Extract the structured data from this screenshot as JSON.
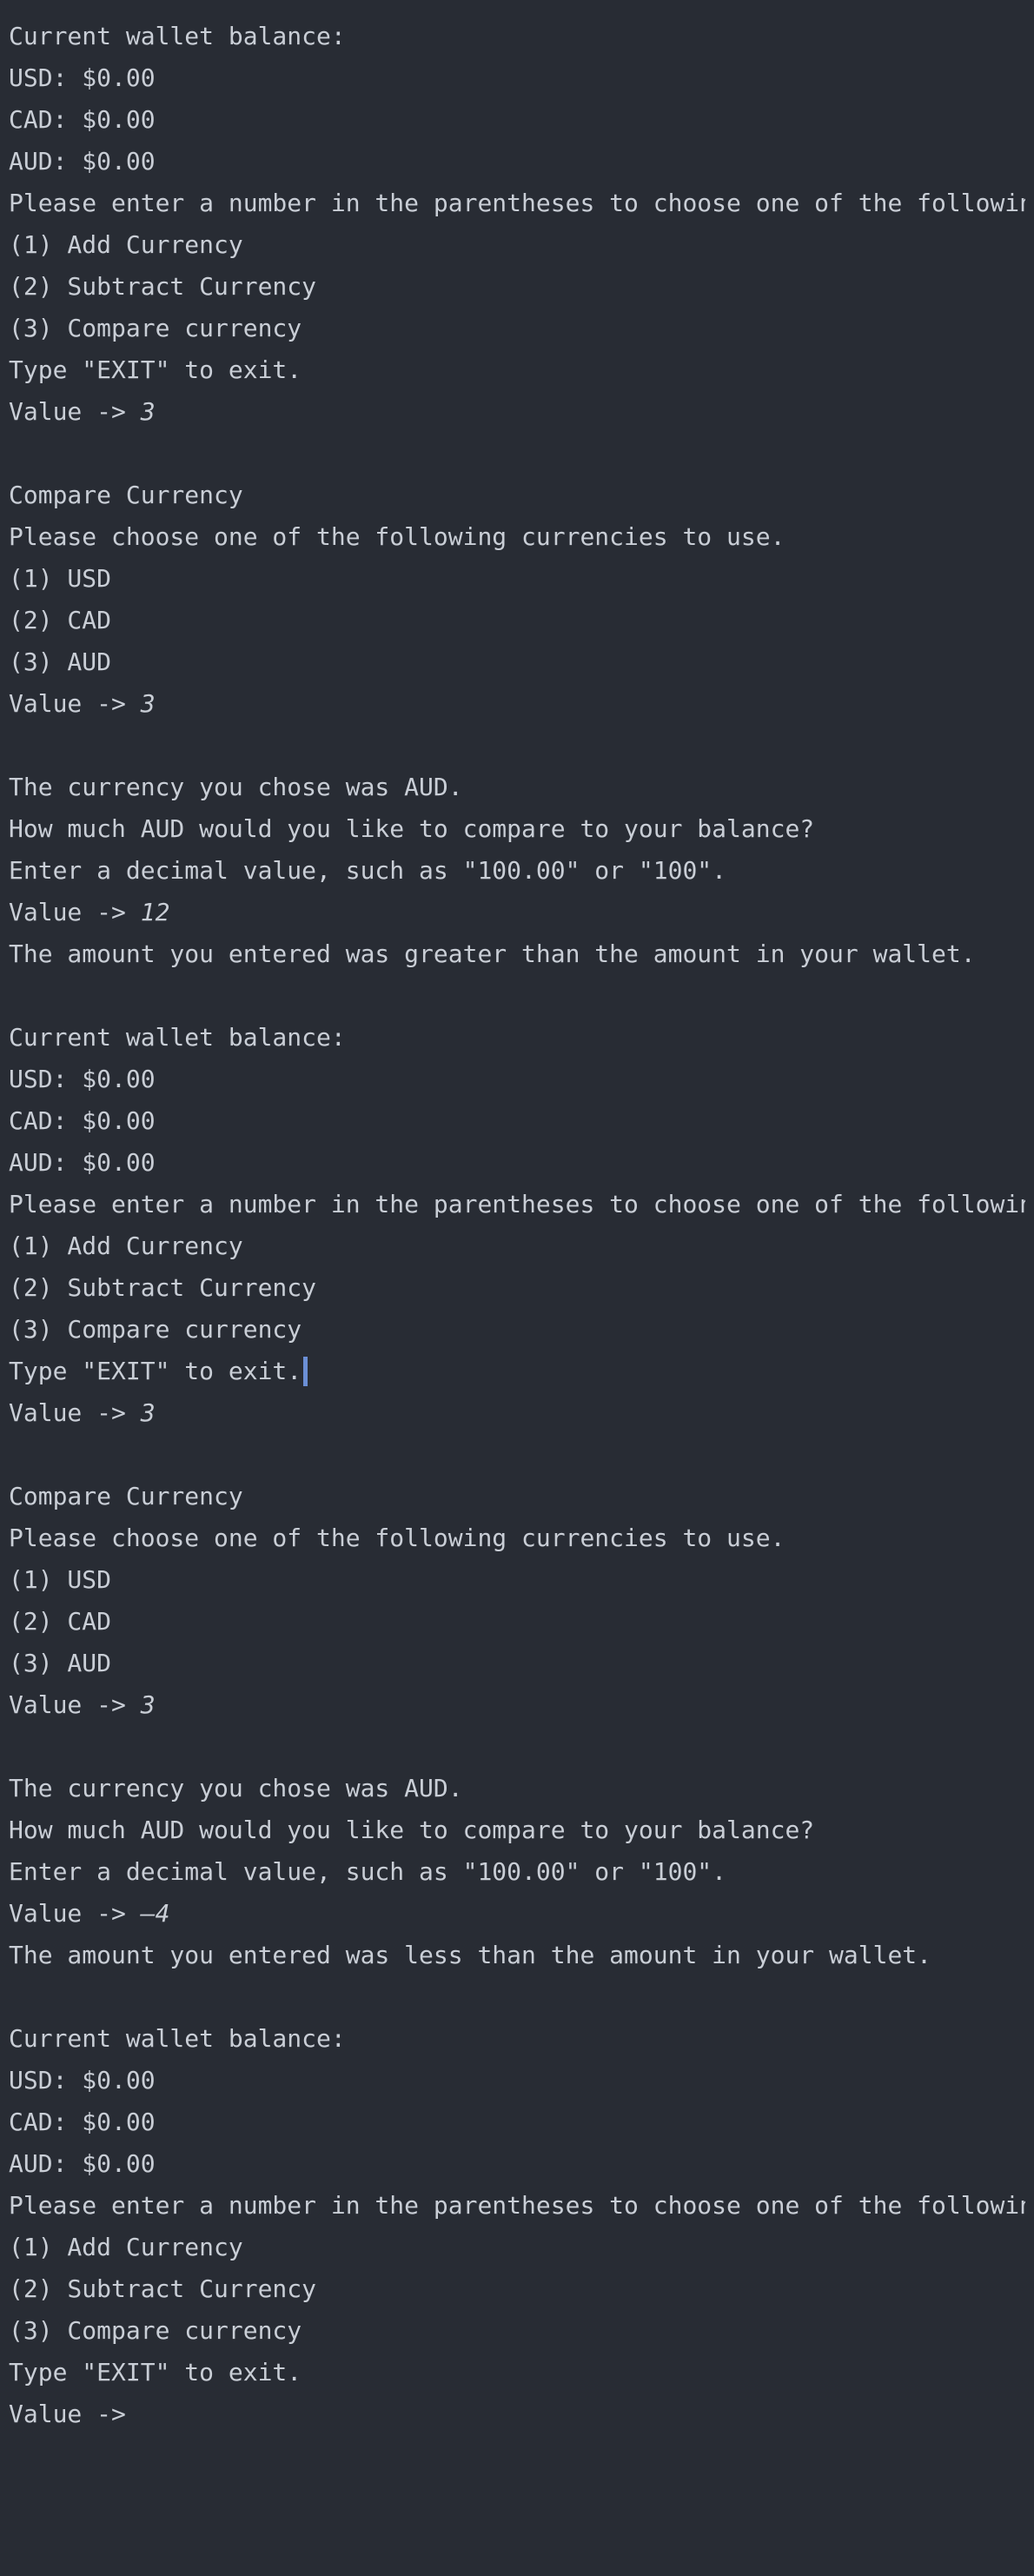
{
  "terminal": {
    "lines": [
      {
        "text": "Current wallet balance:"
      },
      {
        "text": "USD: $0.00"
      },
      {
        "text": "CAD: $0.00"
      },
      {
        "text": "AUD: $0.00"
      },
      {
        "text": "Please enter a number in the parentheses to choose one of the following."
      },
      {
        "text": "(1) Add Currency"
      },
      {
        "text": "(2) Subtract Currency"
      },
      {
        "text": "(3) Compare currency"
      },
      {
        "text": "Type \"EXIT\" to exit."
      },
      {
        "prompt": "Value -> ",
        "input": "3"
      },
      {
        "text": ""
      },
      {
        "text": "Compare Currency"
      },
      {
        "text": "Please choose one of the following currencies to use."
      },
      {
        "text": "(1) USD"
      },
      {
        "text": "(2) CAD"
      },
      {
        "text": "(3) AUD"
      },
      {
        "prompt": "Value -> ",
        "input": "3"
      },
      {
        "text": ""
      },
      {
        "text": "The currency you chose was AUD."
      },
      {
        "text": "How much AUD would you like to compare to your balance?"
      },
      {
        "text": "Enter a decimal value, such as \"100.00\" or \"100\"."
      },
      {
        "prompt": "Value -> ",
        "input": "12"
      },
      {
        "text": "The amount you entered was greater than the amount in your wallet."
      },
      {
        "text": ""
      },
      {
        "text": "Current wallet balance:"
      },
      {
        "text": "USD: $0.00"
      },
      {
        "text": "CAD: $0.00"
      },
      {
        "text": "AUD: $0.00"
      },
      {
        "text": "Please enter a number in the parentheses to choose one of the following."
      },
      {
        "text": "(1) Add Currency"
      },
      {
        "text": "(2) Subtract Currency"
      },
      {
        "text": "(3) Compare currency"
      },
      {
        "text": "Type \"EXIT\" to exit.",
        "cursor": true
      },
      {
        "prompt": "Value -> ",
        "input": "3"
      },
      {
        "text": ""
      },
      {
        "text": "Compare Currency"
      },
      {
        "text": "Please choose one of the following currencies to use."
      },
      {
        "text": "(1) USD"
      },
      {
        "text": "(2) CAD"
      },
      {
        "text": "(3) AUD"
      },
      {
        "prompt": "Value -> ",
        "input": "3"
      },
      {
        "text": ""
      },
      {
        "text": "The currency you chose was AUD."
      },
      {
        "text": "How much AUD would you like to compare to your balance?"
      },
      {
        "text": "Enter a decimal value, such as \"100.00\" or \"100\"."
      },
      {
        "prompt": "Value -> ",
        "input": "–4"
      },
      {
        "text": "The amount you entered was less than the amount in your wallet."
      },
      {
        "text": ""
      },
      {
        "text": "Current wallet balance:"
      },
      {
        "text": "USD: $0.00"
      },
      {
        "text": "CAD: $0.00"
      },
      {
        "text": "AUD: $0.00"
      },
      {
        "text": "Please enter a number in the parentheses to choose one of the following."
      },
      {
        "text": "(1) Add Currency"
      },
      {
        "text": "(2) Subtract Currency"
      },
      {
        "text": "(3) Compare currency"
      },
      {
        "text": "Type \"EXIT\" to exit."
      },
      {
        "prompt": "Value ->",
        "input": ""
      }
    ]
  }
}
